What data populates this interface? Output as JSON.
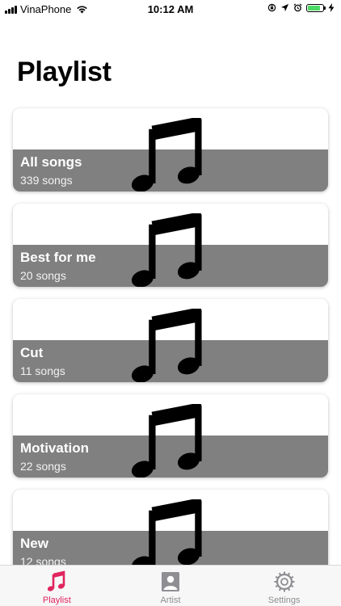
{
  "status_bar": {
    "carrier": "VinaPhone",
    "time": "10:12 AM",
    "battery_level": 0.85,
    "battery_color": "#4cd964"
  },
  "page": {
    "title": "Playlist"
  },
  "playlists": [
    {
      "name": "All songs",
      "count": "339 songs",
      "icon": "music-note-icon"
    },
    {
      "name": "Best for me",
      "count": "20 songs",
      "icon": "music-note-icon"
    },
    {
      "name": "Cut",
      "count": "11 songs",
      "icon": "music-note-icon"
    },
    {
      "name": "Motivation",
      "count": "22 songs",
      "icon": "music-note-icon"
    },
    {
      "name": "New",
      "count": "12 songs",
      "icon": "music-note-icon"
    }
  ],
  "tabs": [
    {
      "label": "Playlist",
      "icon": "music-note-icon",
      "active": true
    },
    {
      "label": "Artist",
      "icon": "person-icon",
      "active": false
    },
    {
      "label": "Settings",
      "icon": "gear-icon",
      "active": false
    }
  ],
  "colors": {
    "accent": "#e0245e",
    "inactive_tab": "#8e8e93",
    "card_band": "#808080"
  }
}
